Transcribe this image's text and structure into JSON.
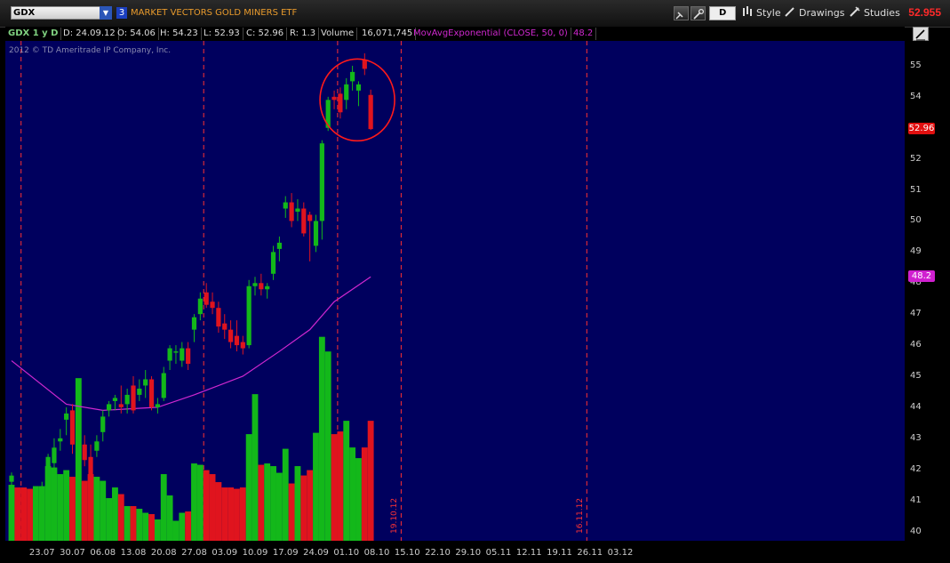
{
  "topbar": {
    "symbol": "GDX",
    "link_group": "3",
    "description": "MARKET VECTORS GOLD MINERS ETF",
    "aggregation": "D",
    "style_label": "Style",
    "drawings_label": "Drawings",
    "studies_label": "Studies",
    "last_price": "52.955"
  },
  "infobar": {
    "period": "GDX 1 y D",
    "date": "D: 24.09.12",
    "open": "O: 54.06",
    "high": "H: 54.23",
    "low": "L: 52.93",
    "close": "C: 52.96",
    "range": "R: 1.3",
    "volume_label": "Volume",
    "volume_value": "16,071,745",
    "study_label": "MovAvgExponential (CLOSE, 50, 0)",
    "study_value": "48.2"
  },
  "copyright": "2012 © TD Ameritrade IP Company, Inc.",
  "colors": {
    "up": "#13b81a",
    "down": "#e0141e",
    "ma": "#d028d0",
    "background": "#00005e",
    "grid": "#ff3030",
    "last_badge": "#e01010",
    "ma_badge": "#d020d0"
  },
  "chart_data": {
    "type": "candlestick",
    "ylim": [
      39.7,
      55.8
    ],
    "yticks": [
      40,
      41,
      42,
      43,
      44,
      45,
      46,
      47,
      48,
      49,
      50,
      51,
      52,
      53,
      54,
      55
    ],
    "x_labels": [
      "23.07",
      "30.07",
      "06.08",
      "13.08",
      "20.08",
      "27.08",
      "03.09",
      "10.09",
      "17.09",
      "24.09",
      "01.10",
      "08.10",
      "15.10",
      "22.10",
      "29.10",
      "05.11",
      "12.11",
      "19.11",
      "26.11",
      "03.12"
    ],
    "vertical_markers": [
      "19.10.12",
      "16.11.12"
    ],
    "price_labels": {
      "last": "52.96",
      "ma": "48.2"
    },
    "candles": [
      {
        "date": "16.07",
        "open": 41.6,
        "high": 41.9,
        "low": 41.3,
        "close": 41.8,
        "volume": 42
      },
      {
        "date": "17.07",
        "open": 41.0,
        "high": 41.2,
        "low": 40.6,
        "close": 40.8,
        "volume": 40
      },
      {
        "date": "18.07",
        "open": 40.9,
        "high": 41.1,
        "low": 40.5,
        "close": 40.7,
        "volume": 40
      },
      {
        "date": "19.07",
        "open": 41.1,
        "high": 41.3,
        "low": 40.8,
        "close": 40.9,
        "volume": 39
      },
      {
        "date": "20.07",
        "open": 40.7,
        "high": 41.1,
        "low": 40.5,
        "close": 41.0,
        "volume": 41
      },
      {
        "date": "23.07",
        "open": 41.2,
        "high": 41.6,
        "low": 40.9,
        "close": 41.4,
        "volume": 41
      },
      {
        "date": "24.07",
        "open": 42.0,
        "high": 42.5,
        "low": 41.8,
        "close": 42.4,
        "volume": 56
      },
      {
        "date": "25.07",
        "open": 42.2,
        "high": 43.0,
        "low": 42.0,
        "close": 42.7,
        "volume": 55
      },
      {
        "date": "26.07",
        "open": 42.9,
        "high": 43.3,
        "low": 42.6,
        "close": 43.0,
        "volume": 50
      },
      {
        "date": "27.07",
        "open": 43.6,
        "high": 44.0,
        "low": 43.1,
        "close": 43.8,
        "volume": 53
      },
      {
        "date": "30.07",
        "open": 43.9,
        "high": 44.1,
        "low": 42.5,
        "close": 42.8,
        "volume": 48
      },
      {
        "date": "31.07",
        "open": 42.9,
        "high": 43.5,
        "low": 42.4,
        "close": 43.2,
        "volume": 122
      },
      {
        "date": "01.08",
        "open": 42.8,
        "high": 43.1,
        "low": 42.1,
        "close": 42.3,
        "volume": 45
      },
      {
        "date": "02.08",
        "open": 42.4,
        "high": 42.8,
        "low": 41.4,
        "close": 41.8,
        "volume": 50
      },
      {
        "date": "03.08",
        "open": 42.6,
        "high": 43.1,
        "low": 42.4,
        "close": 42.9,
        "volume": 48
      },
      {
        "date": "06.08",
        "open": 43.2,
        "high": 43.9,
        "low": 42.9,
        "close": 43.7,
        "volume": 45
      },
      {
        "date": "07.08",
        "open": 43.9,
        "high": 44.2,
        "low": 43.7,
        "close": 44.1,
        "volume": 32
      },
      {
        "date": "08.08",
        "open": 44.2,
        "high": 44.4,
        "low": 43.9,
        "close": 44.3,
        "volume": 40
      },
      {
        "date": "09.08",
        "open": 44.1,
        "high": 44.7,
        "low": 43.8,
        "close": 44.0,
        "volume": 35
      },
      {
        "date": "10.08",
        "open": 44.1,
        "high": 44.6,
        "low": 43.8,
        "close": 44.4,
        "volume": 26
      },
      {
        "date": "13.08",
        "open": 44.7,
        "high": 45.0,
        "low": 43.8,
        "close": 43.9,
        "volume": 26
      },
      {
        "date": "14.08",
        "open": 44.4,
        "high": 44.9,
        "low": 44.2,
        "close": 44.6,
        "volume": 24
      },
      {
        "date": "15.08",
        "open": 44.7,
        "high": 45.2,
        "low": 44.3,
        "close": 44.9,
        "volume": 21
      },
      {
        "date": "16.08",
        "open": 44.9,
        "high": 45.0,
        "low": 43.9,
        "close": 44.0,
        "volume": 20
      },
      {
        "date": "17.08",
        "open": 44.0,
        "high": 44.3,
        "low": 43.8,
        "close": 44.1,
        "volume": 16
      },
      {
        "date": "20.08",
        "open": 44.3,
        "high": 45.3,
        "low": 44.2,
        "close": 45.1,
        "volume": 50
      },
      {
        "date": "21.08",
        "open": 45.5,
        "high": 46.0,
        "low": 45.2,
        "close": 45.9,
        "volume": 34
      },
      {
        "date": "22.08",
        "open": 45.8,
        "high": 46.0,
        "low": 45.4,
        "close": 45.8,
        "volume": 15
      },
      {
        "date": "23.08",
        "open": 45.5,
        "high": 46.1,
        "low": 45.3,
        "close": 45.9,
        "volume": 21
      },
      {
        "date": "24.08",
        "open": 45.9,
        "high": 46.1,
        "low": 45.2,
        "close": 45.4,
        "volume": 22
      },
      {
        "date": "27.08",
        "open": 46.5,
        "high": 47.0,
        "low": 46.1,
        "close": 46.9,
        "volume": 58
      },
      {
        "date": "28.08",
        "open": 47.0,
        "high": 47.7,
        "low": 46.8,
        "close": 47.5,
        "volume": 57
      },
      {
        "date": "29.08",
        "open": 47.7,
        "high": 48.0,
        "low": 47.2,
        "close": 47.3,
        "volume": 53
      },
      {
        "date": "30.08",
        "open": 47.4,
        "high": 47.7,
        "low": 47.0,
        "close": 47.2,
        "volume": 50
      },
      {
        "date": "31.08",
        "open": 47.2,
        "high": 47.4,
        "low": 46.4,
        "close": 46.6,
        "volume": 44
      },
      {
        "date": "03.09",
        "open": 46.7,
        "high": 47.0,
        "low": 46.2,
        "close": 46.5,
        "volume": 40
      },
      {
        "date": "04.09",
        "open": 46.5,
        "high": 46.8,
        "low": 45.9,
        "close": 46.1,
        "volume": 40
      },
      {
        "date": "05.09",
        "open": 46.3,
        "high": 46.8,
        "low": 45.8,
        "close": 46.0,
        "volume": 39
      },
      {
        "date": "06.09",
        "open": 46.1,
        "high": 46.3,
        "low": 45.7,
        "close": 45.9,
        "volume": 40
      },
      {
        "date": "07.09",
        "open": 46.0,
        "high": 48.1,
        "low": 45.9,
        "close": 47.9,
        "volume": 80
      },
      {
        "date": "10.09",
        "open": 47.9,
        "high": 48.2,
        "low": 47.6,
        "close": 48.0,
        "volume": 110
      },
      {
        "date": "11.09",
        "open": 48.0,
        "high": 48.3,
        "low": 47.6,
        "close": 47.8,
        "volume": 57
      },
      {
        "date": "12.09",
        "open": 47.8,
        "high": 48.0,
        "low": 47.5,
        "close": 47.9,
        "volume": 58
      },
      {
        "date": "13.09",
        "open": 48.3,
        "high": 49.2,
        "low": 48.1,
        "close": 49.0,
        "volume": 56
      },
      {
        "date": "14.09",
        "open": 49.1,
        "high": 49.5,
        "low": 48.7,
        "close": 49.3,
        "volume": 51
      },
      {
        "date": "17.09",
        "open": 50.4,
        "high": 50.8,
        "low": 50.1,
        "close": 50.6,
        "volume": 69
      },
      {
        "date": "18.09",
        "open": 50.6,
        "high": 50.9,
        "low": 49.8,
        "close": 50.0,
        "volume": 43
      },
      {
        "date": "19.09",
        "open": 50.3,
        "high": 50.7,
        "low": 50.0,
        "close": 50.4,
        "volume": 56
      },
      {
        "date": "20.09",
        "open": 50.4,
        "high": 50.6,
        "low": 49.5,
        "close": 49.6,
        "volume": 49
      },
      {
        "date": "21.09",
        "open": 50.2,
        "high": 50.3,
        "low": 48.7,
        "close": 50.0,
        "volume": 53
      },
      {
        "date": "24.09",
        "open": 49.2,
        "high": 50.2,
        "low": 49.0,
        "close": 50.0,
        "volume": 81
      },
      {
        "date": "25.09",
        "open": 50.0,
        "high": 52.6,
        "low": 49.4,
        "close": 52.5,
        "volume": 153
      },
      {
        "date": "26.09",
        "open": 53.0,
        "high": 54.0,
        "low": 52.9,
        "close": 53.9,
        "volume": 142
      },
      {
        "date": "27.09",
        "open": 54.0,
        "high": 54.2,
        "low": 53.6,
        "close": 53.9,
        "volume": 80
      },
      {
        "date": "28.09",
        "open": 54.1,
        "high": 54.3,
        "low": 53.3,
        "close": 53.5,
        "volume": 82
      },
      {
        "date": "01.10",
        "open": 53.9,
        "high": 54.6,
        "low": 53.6,
        "close": 54.4,
        "volume": 90
      },
      {
        "date": "02.10",
        "open": 54.5,
        "high": 55.0,
        "low": 54.2,
        "close": 54.8,
        "volume": 70
      },
      {
        "date": "03.10",
        "open": 54.2,
        "high": 54.5,
        "low": 53.7,
        "close": 54.4,
        "volume": 62
      },
      {
        "date": "04.10",
        "open": 55.2,
        "high": 55.4,
        "low": 54.7,
        "close": 54.9,
        "volume": 70
      },
      {
        "date": "05.10",
        "open": 54.06,
        "high": 54.23,
        "low": 52.93,
        "close": 52.96,
        "volume": 90
      }
    ],
    "moving_average": [
      {
        "date": "16.07",
        "value": 45.5
      },
      {
        "date": "27.07",
        "value": 44.1
      },
      {
        "date": "06.08",
        "value": 43.9
      },
      {
        "date": "17.08",
        "value": 44.0
      },
      {
        "date": "27.08",
        "value": 44.4
      },
      {
        "date": "06.09",
        "value": 45.0
      },
      {
        "date": "14.09",
        "value": 45.8
      },
      {
        "date": "21.09",
        "value": 46.5
      },
      {
        "date": "27.09",
        "value": 47.4
      },
      {
        "date": "05.10",
        "value": 48.2
      }
    ]
  }
}
